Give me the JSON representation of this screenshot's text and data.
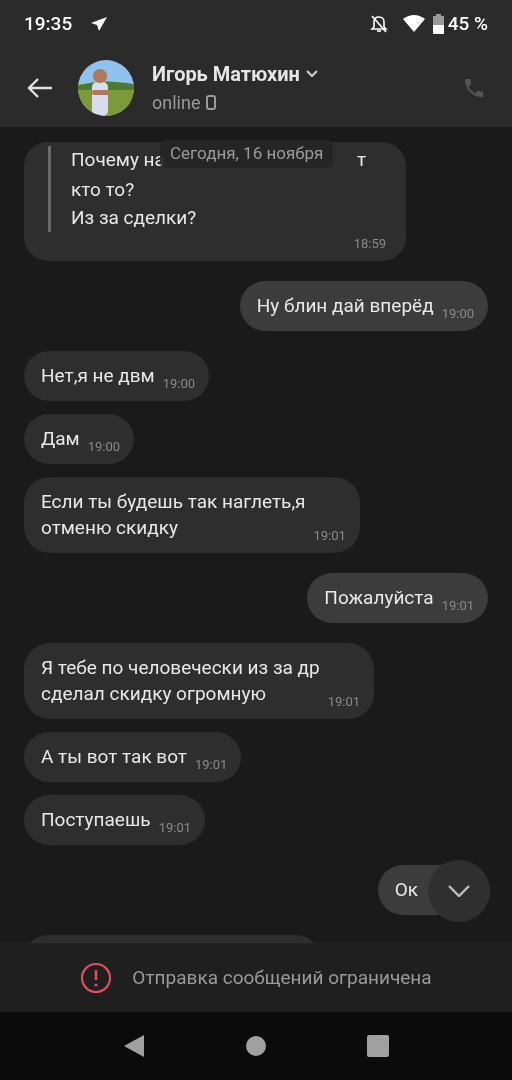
{
  "status_bar": {
    "time": "19:35",
    "battery": "45 %"
  },
  "header": {
    "name": "Игорь Матюхин",
    "status": "online"
  },
  "date_badge": "Сегодня, 16 ноября",
  "messages": [
    {
      "kind": "quote",
      "outgoing": false,
      "first_line": [
        "Почему на",
        "т"
      ],
      "text": "кто то?\nИз за сделки?",
      "time": "18:59"
    },
    {
      "kind": "text",
      "outgoing": true,
      "text": "Ну блин дай вперёд",
      "time": "19:00"
    },
    {
      "kind": "text",
      "outgoing": false,
      "text": "Нет,я не двм",
      "time": "19:00"
    },
    {
      "kind": "text",
      "outgoing": false,
      "text": "Дам",
      "time": "19:00"
    },
    {
      "kind": "text",
      "outgoing": false,
      "text": "Если ты будешь так наглеть,я\nотменю скидку",
      "time": "19:01"
    },
    {
      "kind": "text",
      "outgoing": true,
      "text": "Пожалуйста",
      "time": "19:01"
    },
    {
      "kind": "text",
      "outgoing": false,
      "text": "Я тебе по человечески из за др\nсделал скидку огромную",
      "time": "19:01"
    },
    {
      "kind": "text",
      "outgoing": false,
      "text": "А ты вот так вот",
      "time": "19:01"
    },
    {
      "kind": "text",
      "outgoing": false,
      "text": "Поступаешь",
      "time": "19:01"
    },
    {
      "kind": "text",
      "outgoing": true,
      "text": "Ок"
    },
    {
      "kind": "partial",
      "outgoing": false
    }
  ],
  "restriction_notice": "Отправка сообщений ограничена"
}
